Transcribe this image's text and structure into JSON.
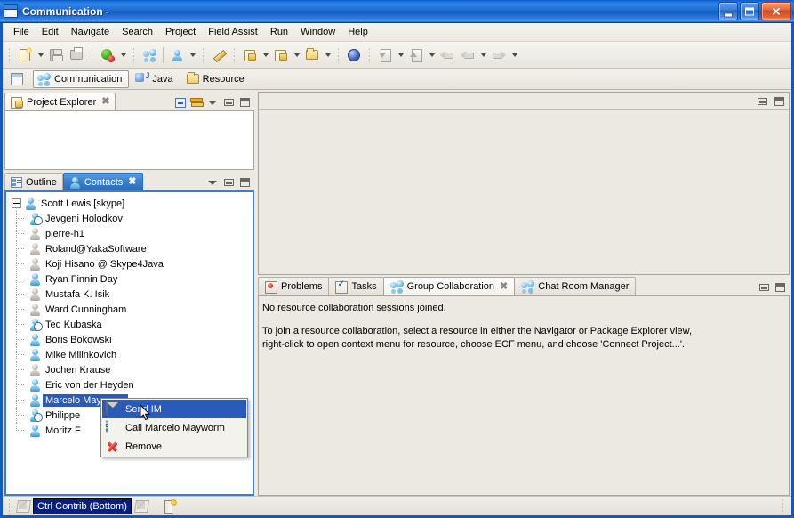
{
  "window": {
    "title": "Communication -",
    "icon": "window-icon",
    "buttons": {
      "minimize": "minimize",
      "maximize": "maximize",
      "close": "close"
    }
  },
  "menubar": {
    "items": [
      {
        "label": "File"
      },
      {
        "label": "Edit"
      },
      {
        "label": "Navigate"
      },
      {
        "label": "Search"
      },
      {
        "label": "Project"
      },
      {
        "label": "Field Assist"
      },
      {
        "label": "Run"
      },
      {
        "label": "Window"
      },
      {
        "label": "Help"
      }
    ]
  },
  "toolbar": {
    "buttons": [
      {
        "name": "new-wizard",
        "icon": "new-document-icon",
        "has_dropdown": true
      },
      {
        "name": "save",
        "icon": "save-icon",
        "has_dropdown": false
      },
      {
        "name": "print",
        "icon": "print-icon",
        "has_dropdown": false
      },
      {
        "name": "run",
        "icon": "run-icon",
        "has_dropdown": true
      },
      {
        "name": "group-collaboration",
        "icon": "people-icon",
        "has_dropdown": false
      },
      {
        "name": "open-connection",
        "icon": "person-icon",
        "has_dropdown": true
      },
      {
        "name": "field-assist",
        "icon": "pen-icon",
        "has_dropdown": false
      },
      {
        "name": "new-resource",
        "icon": "folder-document-icon",
        "has_dropdown": true
      },
      {
        "name": "open-resource",
        "icon": "folder-open-icon",
        "has_dropdown": true
      },
      {
        "name": "new-folder",
        "icon": "folder-icon",
        "has_dropdown": true
      },
      {
        "name": "open-browser",
        "icon": "globe-icon",
        "has_dropdown": false
      },
      {
        "name": "next-annotation",
        "icon": "next-annotation-icon",
        "has_dropdown": true
      },
      {
        "name": "previous-annotation",
        "icon": "previous-annotation-icon",
        "has_dropdown": true
      },
      {
        "name": "last-edit-location",
        "icon": "last-edit-icon",
        "has_dropdown": false
      },
      {
        "name": "back",
        "icon": "arrow-left-icon",
        "has_dropdown": true
      },
      {
        "name": "forward",
        "icon": "arrow-right-icon",
        "has_dropdown": true
      }
    ]
  },
  "perspective_bar": {
    "open_perspective_icon": "open-perspective-icon",
    "perspectives": [
      {
        "label": "Communication",
        "icon": "people-icon",
        "active": true
      },
      {
        "label": "Java",
        "icon": "java-icon",
        "active": false
      },
      {
        "label": "Resource",
        "icon": "folder-icon",
        "active": false
      }
    ]
  },
  "project_explorer": {
    "tab_label": "Project Explorer",
    "tab_icon": "folder-document-icon",
    "close_glyph": "✖",
    "actions": [
      "collapse-all-icon",
      "link-with-editor-icon",
      "view-menu-icon",
      "minimize-icon",
      "maximize-icon"
    ],
    "content": ""
  },
  "contacts_stack": {
    "tabs": [
      {
        "label": "Outline",
        "icon": "outline-icon",
        "active": false
      },
      {
        "label": "Contacts",
        "icon": "person-icon",
        "active": true,
        "close_glyph": "✖"
      }
    ],
    "actions": [
      "view-menu-icon",
      "minimize-icon",
      "maximize-icon"
    ],
    "tree": {
      "root": {
        "label": "Scott Lewis [skype]",
        "status": "online",
        "expanded": true
      },
      "children": [
        {
          "label": "Jevgeni Holodkov",
          "status": "away"
        },
        {
          "label": "pierre-h1",
          "status": "offline"
        },
        {
          "label": "Roland@YakaSoftware",
          "status": "offline"
        },
        {
          "label": "Koji Hisano @ Skype4Java",
          "status": "offline"
        },
        {
          "label": "Ryan Finnin Day",
          "status": "online"
        },
        {
          "label": "Mustafa K. Isik",
          "status": "offline"
        },
        {
          "label": "Ward Cunningham",
          "status": "offline"
        },
        {
          "label": "Ted Kubaska",
          "status": "away"
        },
        {
          "label": "Boris Bokowski",
          "status": "online"
        },
        {
          "label": "Mike Milinkovich",
          "status": "online"
        },
        {
          "label": "Jochen Krause",
          "status": "offline"
        },
        {
          "label": "Eric von der Heyden",
          "status": "online"
        },
        {
          "label": "Marcelo Mayworm",
          "status": "online",
          "selected": true
        },
        {
          "label": "Philippe",
          "status": "away"
        },
        {
          "label": "Moritz F",
          "status": "online"
        }
      ]
    }
  },
  "context_menu": {
    "items": [
      {
        "label": "Send IM",
        "icon": "envelope-icon",
        "highlighted": true
      },
      {
        "label": "Call Marcelo Mayworm",
        "icon": "skype-icon",
        "highlighted": false
      },
      {
        "label": "Remove",
        "icon": "red-x-icon",
        "highlighted": false
      }
    ]
  },
  "editor_area": {
    "actions": [
      "minimize-icon",
      "maximize-icon"
    ]
  },
  "bottom_stack": {
    "tabs": [
      {
        "label": "Problems",
        "icon": "problems-icon",
        "active": false
      },
      {
        "label": "Tasks",
        "icon": "tasks-icon",
        "active": false
      },
      {
        "label": "Group Collaboration",
        "icon": "people-icon",
        "active": true,
        "close_glyph": "✖"
      },
      {
        "label": "Chat Room Manager",
        "icon": "people-icon",
        "active": false
      }
    ],
    "actions": [
      "minimize-icon",
      "maximize-icon"
    ],
    "body": {
      "line1": "No resource collaboration sessions joined.",
      "line2": "To join a resource collaboration, select a resource in either the Navigator or Package Explorer view,",
      "line3": "right-click to open context menu for resource, choose ECF menu, and choose 'Connect Project...'."
    }
  },
  "statusbar": {
    "left_icon": "pencil-icon",
    "contribution_label": "Ctrl Contrib (Bottom)",
    "right_icon": "pencil-icon",
    "far_icon": "book-icon"
  },
  "colors": {
    "titlebar_blue": "#1459bf",
    "accent_selection": "#2a5bb8",
    "active_tab_blue": "#3b82ce",
    "status_contrib_bg": "#0a1f7a",
    "workbench_bg": "#ece9e3"
  }
}
